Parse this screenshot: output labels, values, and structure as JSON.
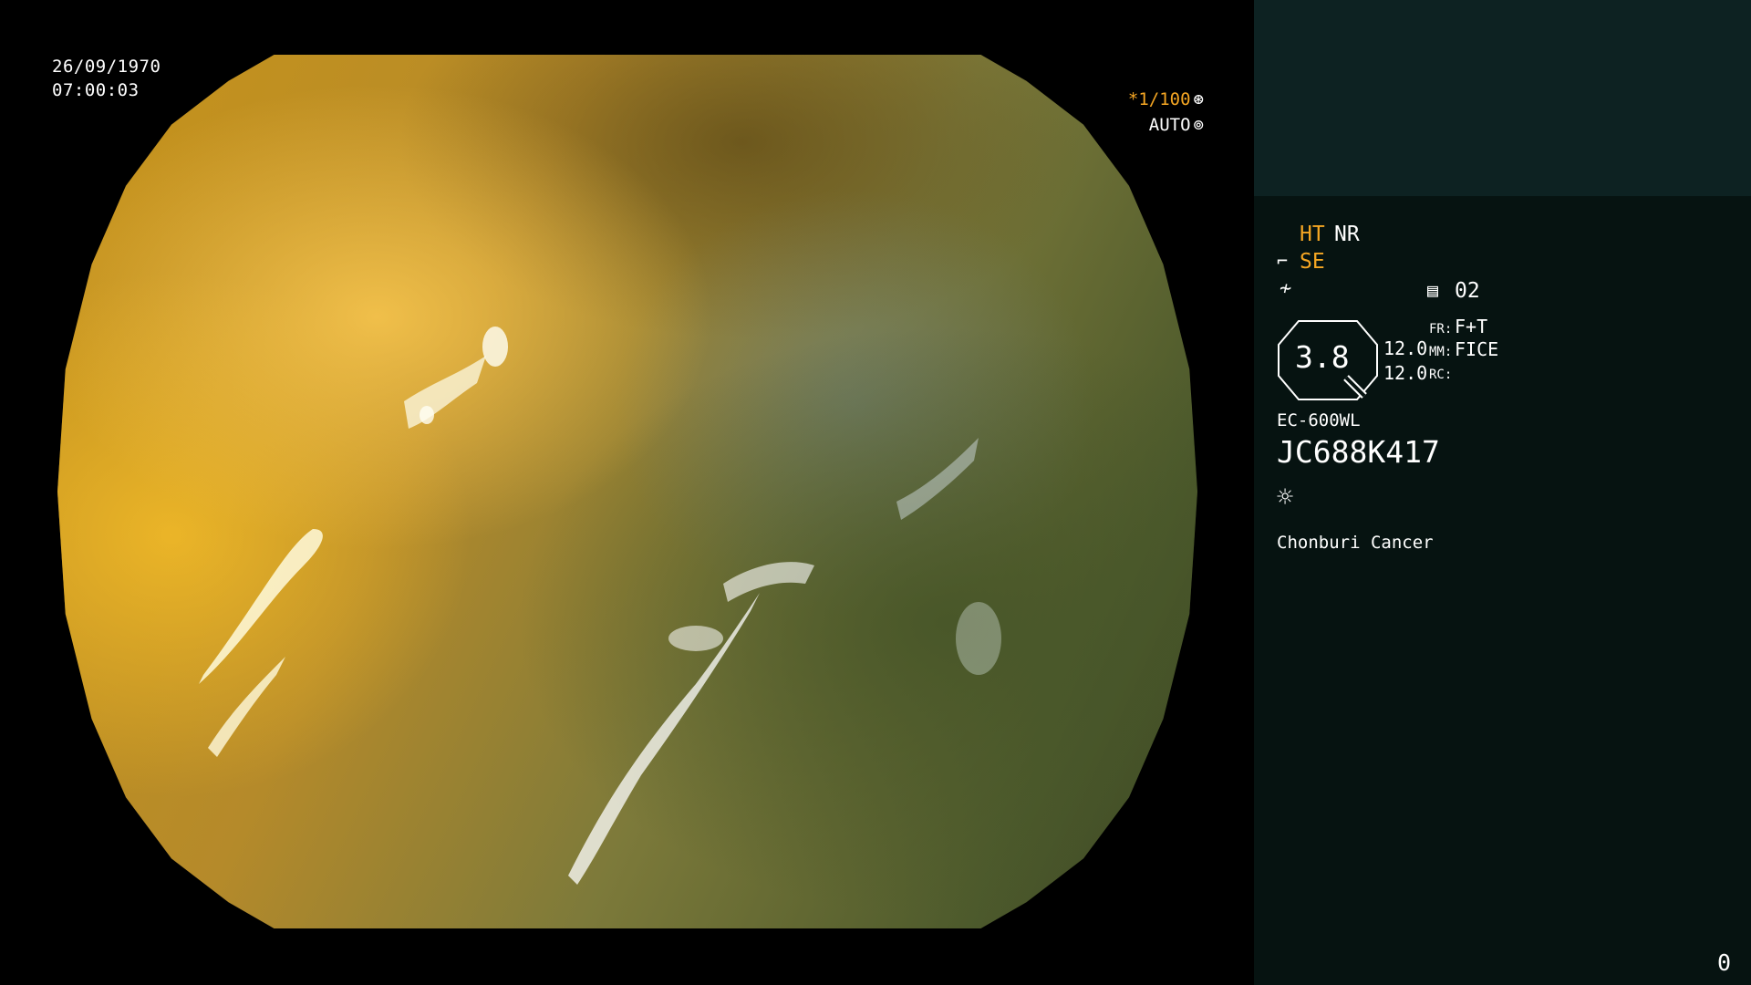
{
  "overlay": {
    "date": "26/09/1970",
    "time": "07:00:03",
    "shutter": "*1/100",
    "exposure_mode": "AUTO"
  },
  "panel": {
    "ht_label": "HT",
    "nr_label": "NR",
    "se_label": "SE",
    "storage_count": "02",
    "zoom_value": "3.8",
    "value_1": "12.0",
    "value_2": "12.0",
    "fr_label": "FR:",
    "fr_value": "F+T",
    "mm_label": "MM:",
    "mm_value": "FICE",
    "rc_label": "RC:",
    "scope_model": "EC-600WL",
    "scope_id": "JC688K417",
    "institution": "Chonburi Cancer",
    "counter": "0"
  },
  "colors": {
    "accent_orange": "#f5a623",
    "panel_bg": "#061311",
    "panel_top_bg": "#0d2222"
  }
}
